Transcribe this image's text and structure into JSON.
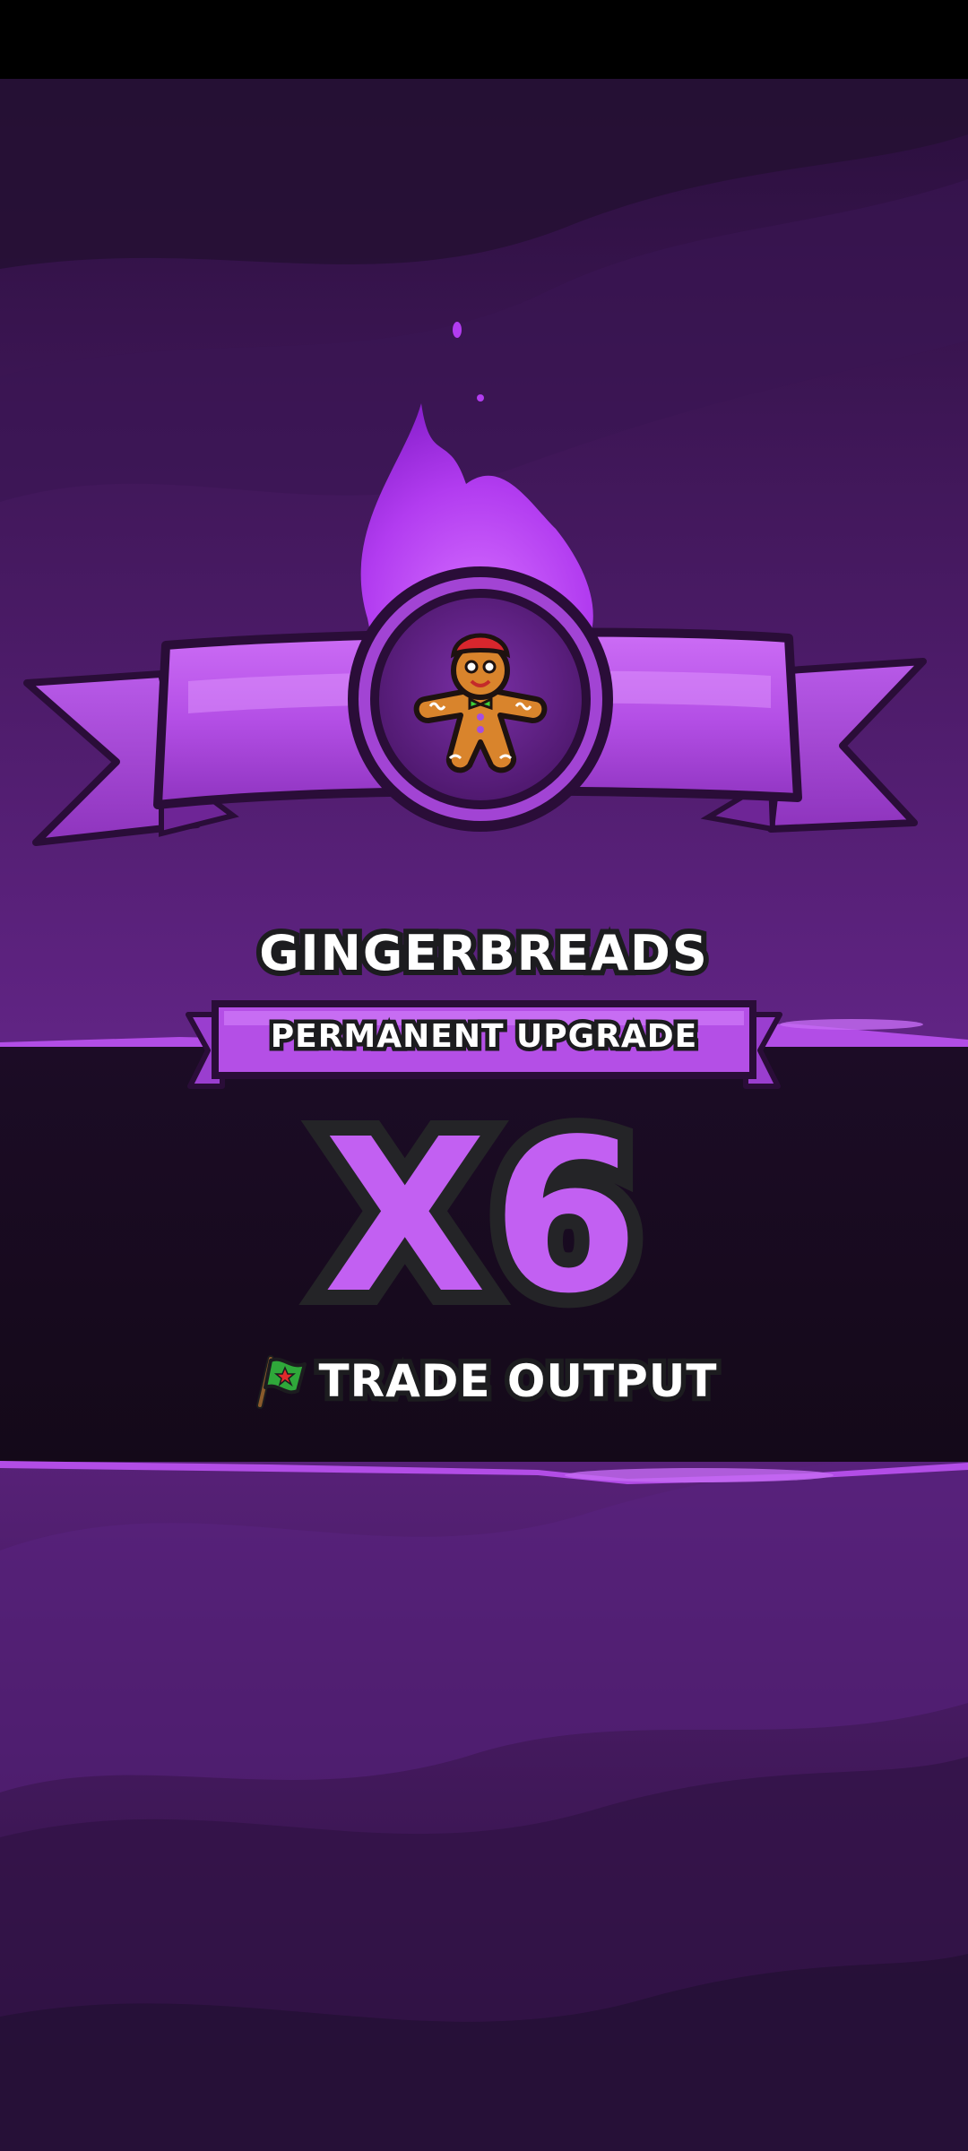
{
  "reward": {
    "item_name": "GINGERBREADS",
    "upgrade_label": "PERMANENT UPGRADE",
    "multiplier": "X6",
    "stat_label": "TRADE OUTPUT",
    "item_icon": "gingerbread-man-icon",
    "stat_icon": "flag-icon"
  },
  "colors": {
    "background_dark": "#2a0f3a",
    "background_mid": "#4e1c6b",
    "band_dark": "#180b20",
    "accent_purple": "#c260f2",
    "ribbon_purple": "#b34fe6",
    "text_outline": "#1c1c1f"
  }
}
